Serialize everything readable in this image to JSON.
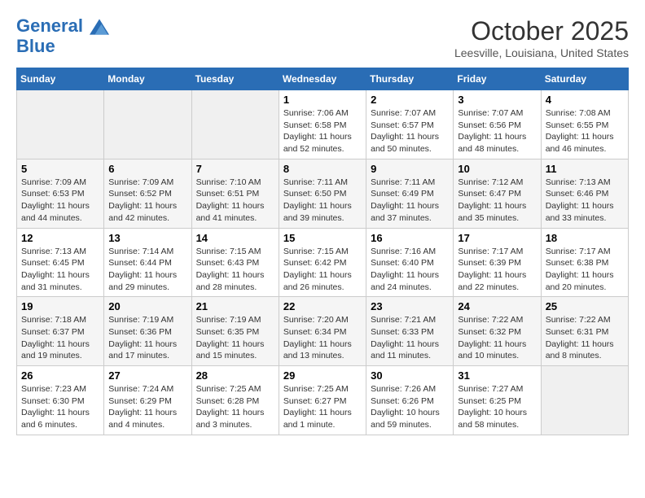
{
  "header": {
    "logo_line1": "General",
    "logo_line2": "Blue",
    "month": "October 2025",
    "location": "Leesville, Louisiana, United States"
  },
  "days_of_week": [
    "Sunday",
    "Monday",
    "Tuesday",
    "Wednesday",
    "Thursday",
    "Friday",
    "Saturday"
  ],
  "weeks": [
    [
      {
        "day": "",
        "info": ""
      },
      {
        "day": "",
        "info": ""
      },
      {
        "day": "",
        "info": ""
      },
      {
        "day": "1",
        "info": "Sunrise: 7:06 AM\nSunset: 6:58 PM\nDaylight: 11 hours\nand 52 minutes."
      },
      {
        "day": "2",
        "info": "Sunrise: 7:07 AM\nSunset: 6:57 PM\nDaylight: 11 hours\nand 50 minutes."
      },
      {
        "day": "3",
        "info": "Sunrise: 7:07 AM\nSunset: 6:56 PM\nDaylight: 11 hours\nand 48 minutes."
      },
      {
        "day": "4",
        "info": "Sunrise: 7:08 AM\nSunset: 6:55 PM\nDaylight: 11 hours\nand 46 minutes."
      }
    ],
    [
      {
        "day": "5",
        "info": "Sunrise: 7:09 AM\nSunset: 6:53 PM\nDaylight: 11 hours\nand 44 minutes."
      },
      {
        "day": "6",
        "info": "Sunrise: 7:09 AM\nSunset: 6:52 PM\nDaylight: 11 hours\nand 42 minutes."
      },
      {
        "day": "7",
        "info": "Sunrise: 7:10 AM\nSunset: 6:51 PM\nDaylight: 11 hours\nand 41 minutes."
      },
      {
        "day": "8",
        "info": "Sunrise: 7:11 AM\nSunset: 6:50 PM\nDaylight: 11 hours\nand 39 minutes."
      },
      {
        "day": "9",
        "info": "Sunrise: 7:11 AM\nSunset: 6:49 PM\nDaylight: 11 hours\nand 37 minutes."
      },
      {
        "day": "10",
        "info": "Sunrise: 7:12 AM\nSunset: 6:47 PM\nDaylight: 11 hours\nand 35 minutes."
      },
      {
        "day": "11",
        "info": "Sunrise: 7:13 AM\nSunset: 6:46 PM\nDaylight: 11 hours\nand 33 minutes."
      }
    ],
    [
      {
        "day": "12",
        "info": "Sunrise: 7:13 AM\nSunset: 6:45 PM\nDaylight: 11 hours\nand 31 minutes."
      },
      {
        "day": "13",
        "info": "Sunrise: 7:14 AM\nSunset: 6:44 PM\nDaylight: 11 hours\nand 29 minutes."
      },
      {
        "day": "14",
        "info": "Sunrise: 7:15 AM\nSunset: 6:43 PM\nDaylight: 11 hours\nand 28 minutes."
      },
      {
        "day": "15",
        "info": "Sunrise: 7:15 AM\nSunset: 6:42 PM\nDaylight: 11 hours\nand 26 minutes."
      },
      {
        "day": "16",
        "info": "Sunrise: 7:16 AM\nSunset: 6:40 PM\nDaylight: 11 hours\nand 24 minutes."
      },
      {
        "day": "17",
        "info": "Sunrise: 7:17 AM\nSunset: 6:39 PM\nDaylight: 11 hours\nand 22 minutes."
      },
      {
        "day": "18",
        "info": "Sunrise: 7:17 AM\nSunset: 6:38 PM\nDaylight: 11 hours\nand 20 minutes."
      }
    ],
    [
      {
        "day": "19",
        "info": "Sunrise: 7:18 AM\nSunset: 6:37 PM\nDaylight: 11 hours\nand 19 minutes."
      },
      {
        "day": "20",
        "info": "Sunrise: 7:19 AM\nSunset: 6:36 PM\nDaylight: 11 hours\nand 17 minutes."
      },
      {
        "day": "21",
        "info": "Sunrise: 7:19 AM\nSunset: 6:35 PM\nDaylight: 11 hours\nand 15 minutes."
      },
      {
        "day": "22",
        "info": "Sunrise: 7:20 AM\nSunset: 6:34 PM\nDaylight: 11 hours\nand 13 minutes."
      },
      {
        "day": "23",
        "info": "Sunrise: 7:21 AM\nSunset: 6:33 PM\nDaylight: 11 hours\nand 11 minutes."
      },
      {
        "day": "24",
        "info": "Sunrise: 7:22 AM\nSunset: 6:32 PM\nDaylight: 11 hours\nand 10 minutes."
      },
      {
        "day": "25",
        "info": "Sunrise: 7:22 AM\nSunset: 6:31 PM\nDaylight: 11 hours\nand 8 minutes."
      }
    ],
    [
      {
        "day": "26",
        "info": "Sunrise: 7:23 AM\nSunset: 6:30 PM\nDaylight: 11 hours\nand 6 minutes."
      },
      {
        "day": "27",
        "info": "Sunrise: 7:24 AM\nSunset: 6:29 PM\nDaylight: 11 hours\nand 4 minutes."
      },
      {
        "day": "28",
        "info": "Sunrise: 7:25 AM\nSunset: 6:28 PM\nDaylight: 11 hours\nand 3 minutes."
      },
      {
        "day": "29",
        "info": "Sunrise: 7:25 AM\nSunset: 6:27 PM\nDaylight: 11 hours\nand 1 minute."
      },
      {
        "day": "30",
        "info": "Sunrise: 7:26 AM\nSunset: 6:26 PM\nDaylight: 10 hours\nand 59 minutes."
      },
      {
        "day": "31",
        "info": "Sunrise: 7:27 AM\nSunset: 6:25 PM\nDaylight: 10 hours\nand 58 minutes."
      },
      {
        "day": "",
        "info": ""
      }
    ]
  ]
}
